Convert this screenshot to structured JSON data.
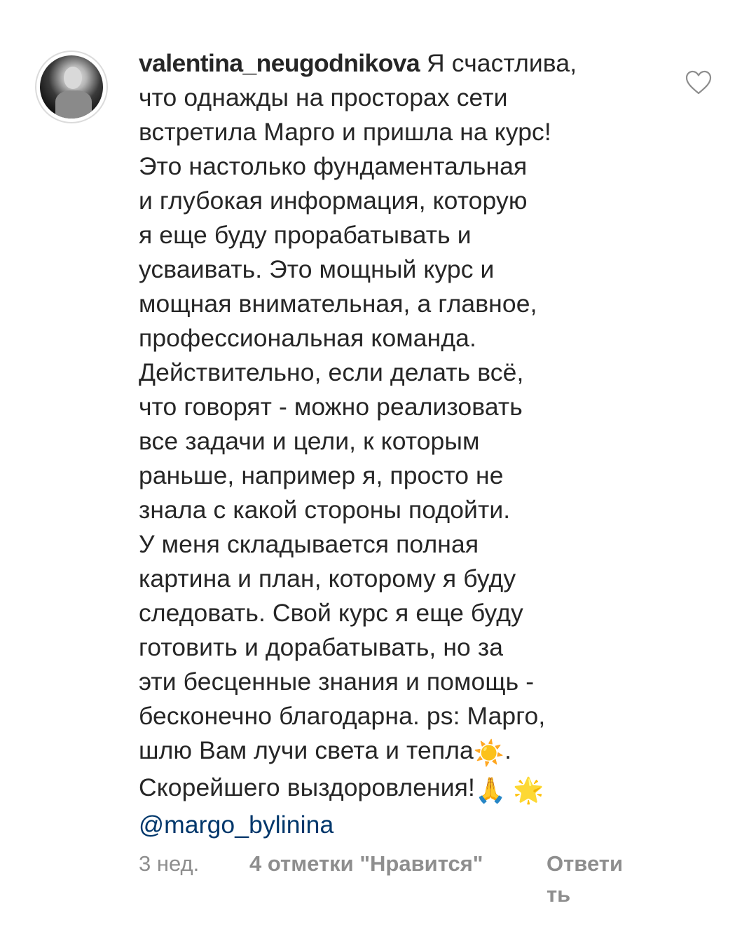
{
  "comment": {
    "username": "valentina_neugodnikova",
    "text_lines": [
      "Я счастлива,",
      "что однажды на просторах сети",
      "встретила Марго и пришла на курс!",
      "Это настолько фундаментальная",
      "и глубокая информация, которую",
      "я еще буду прорабатывать и",
      "усваивать. Это мощный курс и",
      "мощная внимательная, а главное,",
      "профессиональная команда.",
      "Действительно, если делать всё,",
      "что говорят - можно реализовать",
      "все задачи и цели, к которым",
      "раньше, например я, просто не",
      "знала с какой стороны подойти.",
      "У меня складывается полная",
      "картина и план, которому я буду",
      "следовать. Свой курс я еще буду",
      "готовить и дорабатывать, но за",
      "эти бесценные знания и помощь -",
      "бесконечно благодарна. ps: Марго,",
      "шлю Вам лучи света и тепла",
      "Скорейшего выздоровления!"
    ],
    "line21_emoji": "☀️",
    "line21_suffix": ".",
    "line22_emojis": [
      "🙏",
      "🌟"
    ],
    "mention": "@margo_bylinina"
  },
  "footer": {
    "time": "3 нед.",
    "likes": "4 отметки \"Нравится\"",
    "reply": "Ответить"
  },
  "icons": {
    "avatar": "profile-photo",
    "like": "heart-outline-icon"
  },
  "colors": {
    "text": "#262626",
    "secondary": "#8e8e8e",
    "mention": "#00376b"
  }
}
